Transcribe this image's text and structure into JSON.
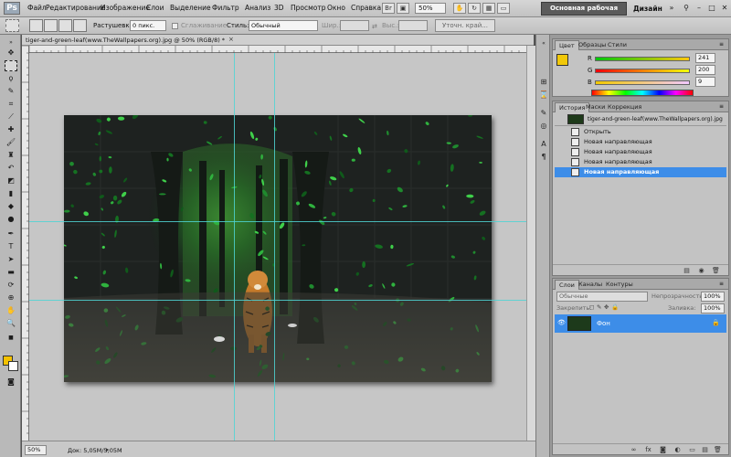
{
  "app": {
    "logo": "Ps"
  },
  "menu": [
    "Файл",
    "Редактирование",
    "Изображение",
    "Слои",
    "Выделение",
    "Фильтр",
    "Анализ",
    "3D",
    "Просмотр",
    "Окно",
    "Справка"
  ],
  "menubar": {
    "zoom": "50%",
    "workspace_button": "Основная рабочая среда",
    "workspace_link": "Дизайн",
    "more": "»",
    "minimize": "–",
    "restore": "□",
    "close": "✕"
  },
  "options": {
    "feather_label": "Растушевка:",
    "feather_value": "0 пикс.",
    "antialias_label": "Сглаживание",
    "style_label": "Стиль:",
    "style_value": "Обычный",
    "width_label": "Шир.:",
    "height_label": "Выс.:",
    "refine_button": "Уточн. край..."
  },
  "document": {
    "tab_title": "tiger-and-green-leaf(www.TheWallpapers.org).jpg @ 50% (RGB/8) *",
    "close": "×",
    "status_zoom": "50%",
    "status_doc": "Док: 5,05M/5,05M"
  },
  "color_panel": {
    "tabs": [
      "Цвет",
      "Образцы",
      "Стили"
    ],
    "r_label": "R",
    "r_value": "241",
    "g_label": "G",
    "g_value": "200",
    "b_label": "B",
    "b_value": "9",
    "fg_color": "#f1c809"
  },
  "history_panel": {
    "tabs": [
      "История",
      "Маски",
      "Коррекция"
    ],
    "snapshot": "tiger-and-green-leaf(www.TheWallpapers.org).jpg",
    "items": [
      "Открыть",
      "Новая направляющая",
      "Новая направляющая",
      "Новая направляющая",
      "Новая направляющая"
    ]
  },
  "layers_panel": {
    "tabs": [
      "Слои",
      "Каналы",
      "Контуры"
    ],
    "blend_mode": "Обычные",
    "opacity_label": "Непрозрачность:",
    "opacity_value": "100%",
    "lock_label": "Закрепить:",
    "fill_label": "Заливка:",
    "fill_value": "100%",
    "layer_name": "Фон"
  },
  "colors": {
    "accent": "#3d8de8",
    "guide": "#4fd4d4",
    "fg": "#f5c200"
  }
}
